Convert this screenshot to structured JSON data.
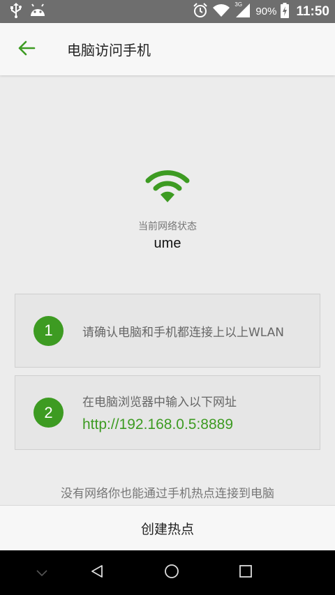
{
  "status_bar": {
    "battery_percent": "90%",
    "time": "11:50",
    "network_type": "3G"
  },
  "app_bar": {
    "title": "电脑访问手机"
  },
  "network": {
    "status_label": "当前网络状态",
    "ssid": "ume"
  },
  "steps": [
    {
      "number": "1",
      "text": "请确认电脑和手机都连接上以上WLAN"
    },
    {
      "number": "2",
      "text": "在电脑浏览器中输入以下网址",
      "url": "http://192.168.0.5:8889"
    }
  ],
  "hint": "没有网络你也能通过手机热点连接到电脑",
  "hotspot_button": "创建热点",
  "colors": {
    "accent": "#3d9b22",
    "status_bar": "#6e6e6e",
    "card_bg": "#e6e6e6"
  }
}
